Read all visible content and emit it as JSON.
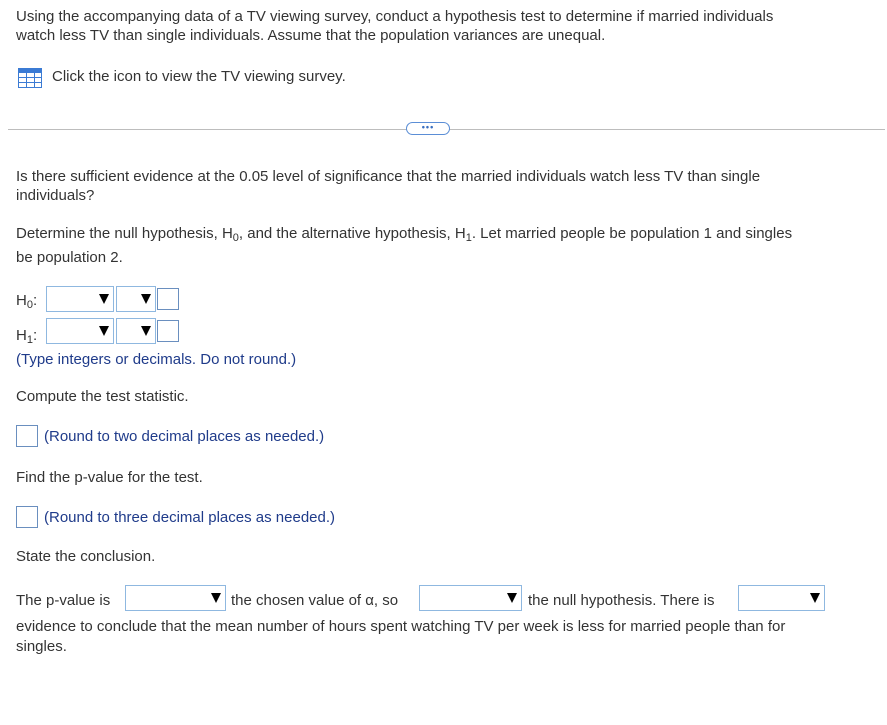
{
  "question": {
    "intro_line1": "Using the accompanying data of a TV viewing survey, conduct a hypothesis test to determine if married individuals",
    "intro_line2": "watch less TV than single individuals. Assume that the population variances are unequal.",
    "data_link": "Click the icon to view the TV viewing survey.",
    "more_button": "•••"
  },
  "part1": {
    "prompt_line1": "Is there sufficient evidence at the 0.05 level of significance that the married individuals watch less TV than single",
    "prompt_line2": "individuals?"
  },
  "hypotheses": {
    "instruction_a": "Determine the null hypothesis, H",
    "sub0": "0",
    "instruction_b": ", and the alternative hypothesis, H",
    "sub1": "1",
    "instruction_c": ". Let married people be population 1 and singles",
    "instruction_line2": "be population 2.",
    "h0_label": "H",
    "h1_label": "H",
    "colon": ":",
    "hint": "(Type integers or decimals. Do not round.)"
  },
  "test_statistic": {
    "prompt": "Compute the test statistic.",
    "hint": "(Round to two decimal places as needed.)"
  },
  "p_value": {
    "prompt": "Find the p-value for the test.",
    "hint": "(Round to three decimal places as needed.)"
  },
  "conclusion": {
    "prompt": "State the conclusion.",
    "text_a": "The p-value is",
    "text_b": "the chosen value of α, so",
    "text_c": "the null hypothesis. There is",
    "text_line2": "evidence to conclude that the mean number of hours spent watching TV per week is less for married people than for",
    "text_line3": "singles."
  }
}
